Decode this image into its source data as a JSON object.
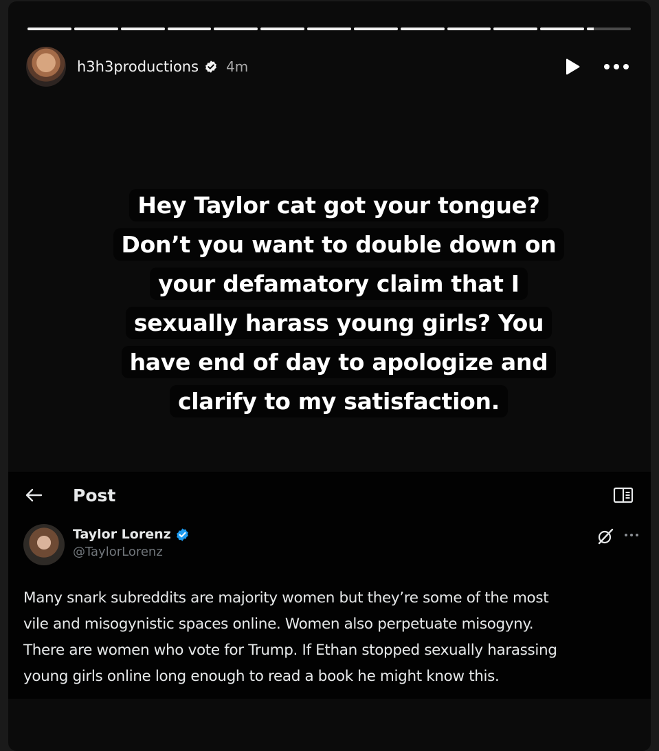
{
  "story": {
    "progress_segments": [
      1,
      1,
      1,
      1,
      1,
      1,
      1,
      1,
      1,
      1,
      1,
      1,
      0.15
    ],
    "username": "h3h3productions",
    "time": "4m",
    "caption_lines": [
      "Hey Taylor cat got your tongue?",
      "Don’t you want to double down on",
      "your defamatory claim that I",
      "sexually harass young girls? You",
      "have end of day to apologize and",
      "clarify to my satisfaction."
    ],
    "icons": {
      "verified": "verified-badge-icon",
      "play": "play-icon",
      "more": "more-horizontal-icon"
    }
  },
  "tweet": {
    "header_title": "Post",
    "display_name": "Taylor Lorenz",
    "handle": "@TaylorLorenz",
    "text_lines": [
      "Many snark subreddits are majority women but they’re some of the most",
      "vile and misogynistic spaces online. Women also perpetuate misogyny.",
      "There are women who vote for Trump. If Ethan stopped sexually harassing",
      "young girls online long enough to read a book he might know this."
    ],
    "icons": {
      "back": "back-arrow-icon",
      "reader": "reader-mode-icon",
      "verified": "verified-badge-icon",
      "grok": "grok-icon",
      "more": "more-horizontal-icon"
    },
    "colors": {
      "verified_blue": "#1d9bf0"
    }
  }
}
